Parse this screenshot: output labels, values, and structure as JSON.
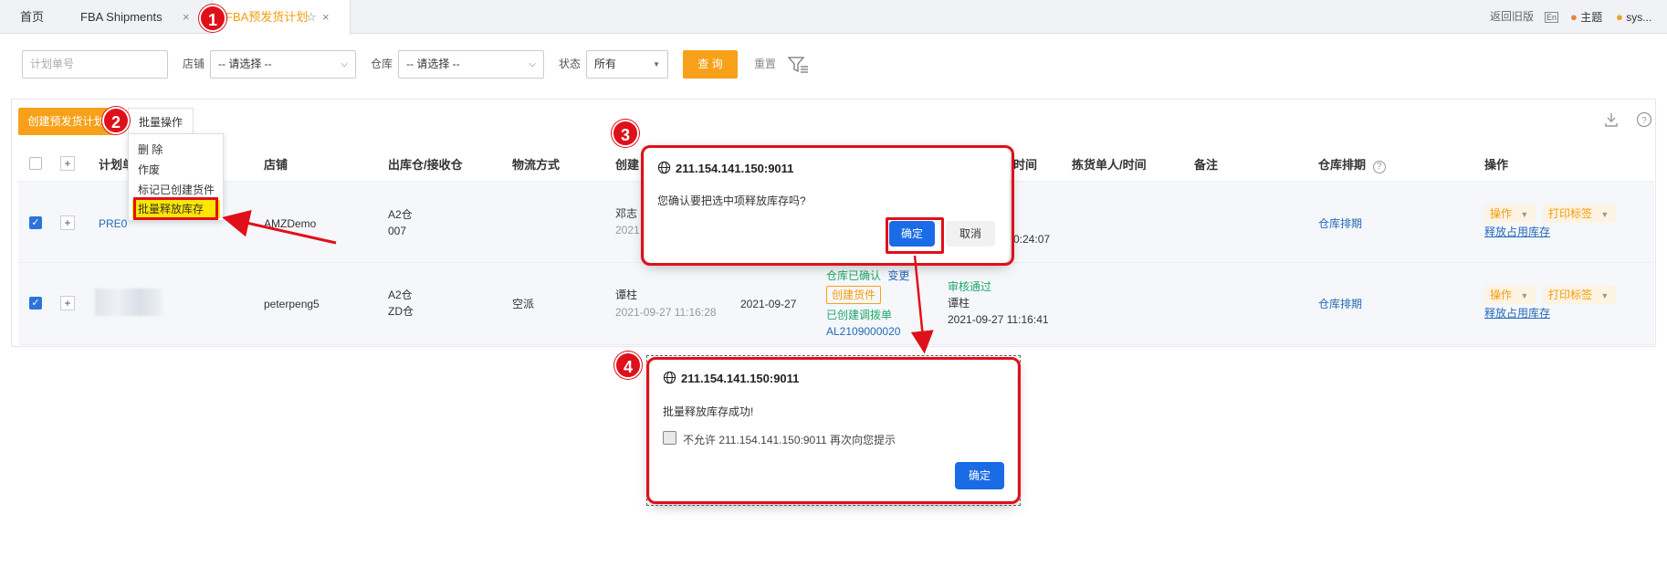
{
  "tabs": {
    "home": "首页",
    "fba_shipments": "FBA Shipments",
    "plan": "FBA预发货计划"
  },
  "topright": {
    "back_old": "返回旧版",
    "lang": "En",
    "theme": "主题",
    "user": "sys..."
  },
  "filters": {
    "plan_no_placeholder": "计划单号",
    "shop_label": "店铺",
    "shop_value": "-- 请选择 --",
    "warehouse_label": "仓库",
    "warehouse_value": "-- 请选择 --",
    "status_label": "状态",
    "status_value": "所有",
    "query": "查 询",
    "reset": "重置"
  },
  "toolbar": {
    "create": "创建预发货计划",
    "batch": "批量操作"
  },
  "batch_menu": [
    "删 除",
    "作废",
    "标记已创建货件",
    "批量释放库存"
  ],
  "columns": {
    "plan_no": "计划单",
    "shop": "店铺",
    "warehouse": "出库仓/接收仓",
    "logistics": "物流方式",
    "creator": "创建",
    "time": "时间",
    "picker": "拣货单人/时间",
    "remark": "备注",
    "wh_schedule": "仓库排期",
    "ops": "操作"
  },
  "rows": [
    {
      "plan_no": "PRE0",
      "shop": "AMZDemo",
      "wh1": "A2仓",
      "wh2": "007",
      "creator": "邓志",
      "creator_time": "2021",
      "time_tail": "0:24:07",
      "wh_schedule": "仓库排期",
      "op": "操作",
      "print": "打印标签",
      "release": "释放占用库存"
    },
    {
      "plan_no": "",
      "shop": "peterpeng5",
      "wh1": "A2仓",
      "wh2": "ZD仓",
      "logistics": "空派",
      "creator": "谭柱",
      "creator_time": "2021-09-27 11:16:28",
      "date": "2021-09-27",
      "status1": "仓库已确认",
      "change": "变更",
      "create_ship": "创建货件",
      "transfer": "已创建调拨单",
      "transfer_no": "AL2109000020",
      "audit": "审核通过",
      "auditor": "谭柱",
      "audit_time": "2021-09-27 11:16:41",
      "wh_schedule": "仓库排期",
      "op": "操作",
      "print": "打印标签",
      "release": "释放占用库存"
    }
  ],
  "dialog1": {
    "host": "211.154.141.150:9011",
    "message": "您确认要把选中项释放库存吗?",
    "ok": "确定",
    "cancel": "取消"
  },
  "dialog2": {
    "host": "211.154.141.150:9011",
    "message": "批量释放库存成功!",
    "checkbox": "不允许 211.154.141.150:9011 再次向您提示",
    "ok": "确定"
  },
  "badges": [
    "1",
    "2",
    "3",
    "4"
  ],
  "colors": {
    "accent_orange": "#f7a11a",
    "annotation_red": "#e0101a",
    "link_blue": "#2569b7",
    "dialog_blue": "#1a6be6",
    "status_green": "#1ea86b"
  }
}
